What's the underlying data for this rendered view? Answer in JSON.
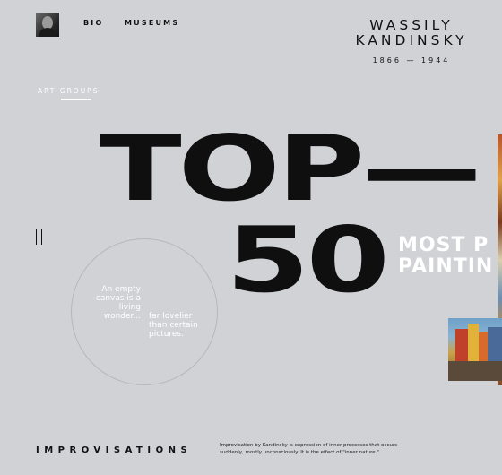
{
  "nav": {
    "bio_label": "BIO",
    "museums_label": "MUSEUMS"
  },
  "brand": {
    "name": "WASSILY\nKANDINSKY",
    "years": "1866 — 1944"
  },
  "section": {
    "label": "ART GROUPS"
  },
  "hero": {
    "line1": "TOP—",
    "line2": "50",
    "side_text": "MOST P\nPAINTIN"
  },
  "quote": {
    "part1": "An empty canvas is a living wonder...",
    "part2": "far lovelier than certain pictures."
  },
  "footer": {
    "title": "IMPROVISATIONS",
    "description": "Improvisation by Kandinsky is expression of inner processes that occurs suddenly, mostly unconsciously. It is the effect of \"inner nature.\""
  },
  "colors": {
    "background": "#d1d2d6",
    "text": "#111111",
    "accent_white": "#ffffff"
  }
}
